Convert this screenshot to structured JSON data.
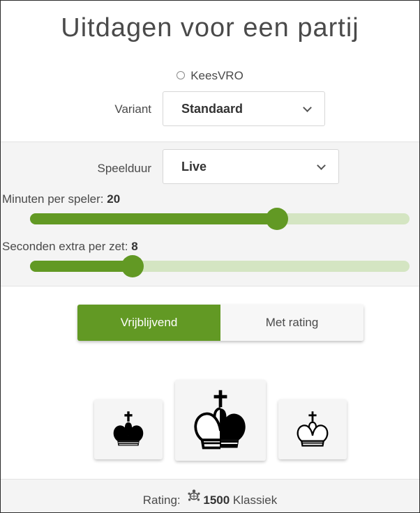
{
  "dialog": {
    "title": "Uitdagen voor een partij",
    "opponent": "KeesVRO"
  },
  "variant": {
    "label": "Variant",
    "selected": "Standaard"
  },
  "time_control": {
    "label": "Speelduur",
    "selected": "Live",
    "minutes": {
      "label": "Minuten per speler: ",
      "value": "20",
      "fraction": 0.65
    },
    "increment": {
      "label": "Seconden extra per zet: ",
      "value": "8",
      "fraction": 0.27
    }
  },
  "mode": {
    "casual_label": "Vrijblijvend",
    "rated_label": "Met rating",
    "active": "casual"
  },
  "colors": {
    "black_icon": "black-king-icon",
    "random_icon": "random-king-icon",
    "white_icon": "white-king-icon"
  },
  "footer": {
    "rating_label": "Rating: ",
    "rating_icon": "turtle-icon",
    "rating_value": "1500",
    "rating_perf": " Klassiek"
  },
  "theme": {
    "accent": "#629924",
    "track": "#d4e5c2"
  }
}
